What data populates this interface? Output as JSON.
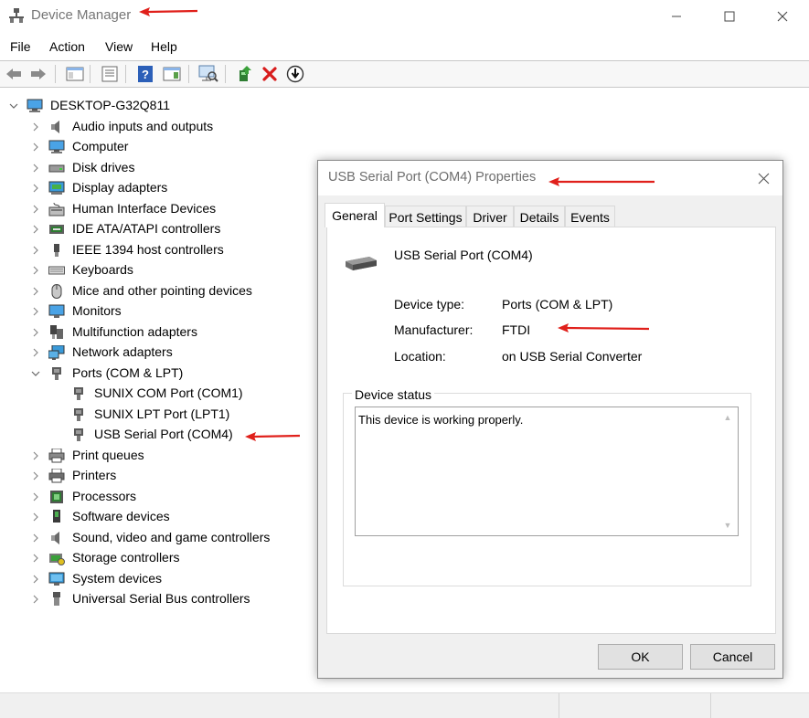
{
  "window": {
    "title": "Device Manager",
    "app_icon": "device-manager-icon",
    "controls": {
      "minimize": "minimize-icon",
      "maximize": "maximize-icon",
      "close": "close-icon"
    }
  },
  "menu": [
    "File",
    "Action",
    "View",
    "Help"
  ],
  "toolbar": {
    "buttons": [
      "back-arrow-icon",
      "forward-arrow-icon",
      "show-hide-console-tree-icon",
      "properties-icon",
      "help-icon",
      "action-pane-icon",
      "scan-hardware-icon",
      "update-driver-icon",
      "uninstall-icon",
      "disable-device-icon"
    ]
  },
  "tree": {
    "root": "DESKTOP-G32Q811",
    "categories": [
      "Audio inputs and outputs",
      "Computer",
      "Disk drives",
      "Display adapters",
      "Human Interface Devices",
      "IDE ATA/ATAPI controllers",
      "IEEE 1394 host controllers",
      "Keyboards",
      "Mice and other pointing devices",
      "Monitors",
      "Multifunction adapters",
      "Network adapters",
      "Ports (COM & LPT)",
      "Print queues",
      "Printers",
      "Processors",
      "Software devices",
      "Sound, video and game controllers",
      "Storage controllers",
      "System devices",
      "Universal Serial Bus controllers"
    ],
    "expanded_category": "Ports (COM & LPT)",
    "ports_children": [
      "SUNIX COM Port (COM1)",
      "SUNIX LPT Port (LPT1)",
      "USB Serial Port (COM4)"
    ]
  },
  "dialog": {
    "title": "USB Serial Port (COM4) Properties",
    "tabs": [
      "General",
      "Port Settings",
      "Driver",
      "Details",
      "Events"
    ],
    "active_tab": "General",
    "device_name": "USB Serial Port (COM4)",
    "properties": [
      {
        "label": "Device type:",
        "value": "Ports (COM & LPT)"
      },
      {
        "label": "Manufacturer:",
        "value": "FTDI"
      },
      {
        "label": "Location:",
        "value": "on USB Serial Converter"
      }
    ],
    "status_group_label": "Device status",
    "status_text": "This device is working properly.",
    "ok_label": "OK",
    "cancel_label": "Cancel"
  },
  "annotation_color": "#e0201b"
}
